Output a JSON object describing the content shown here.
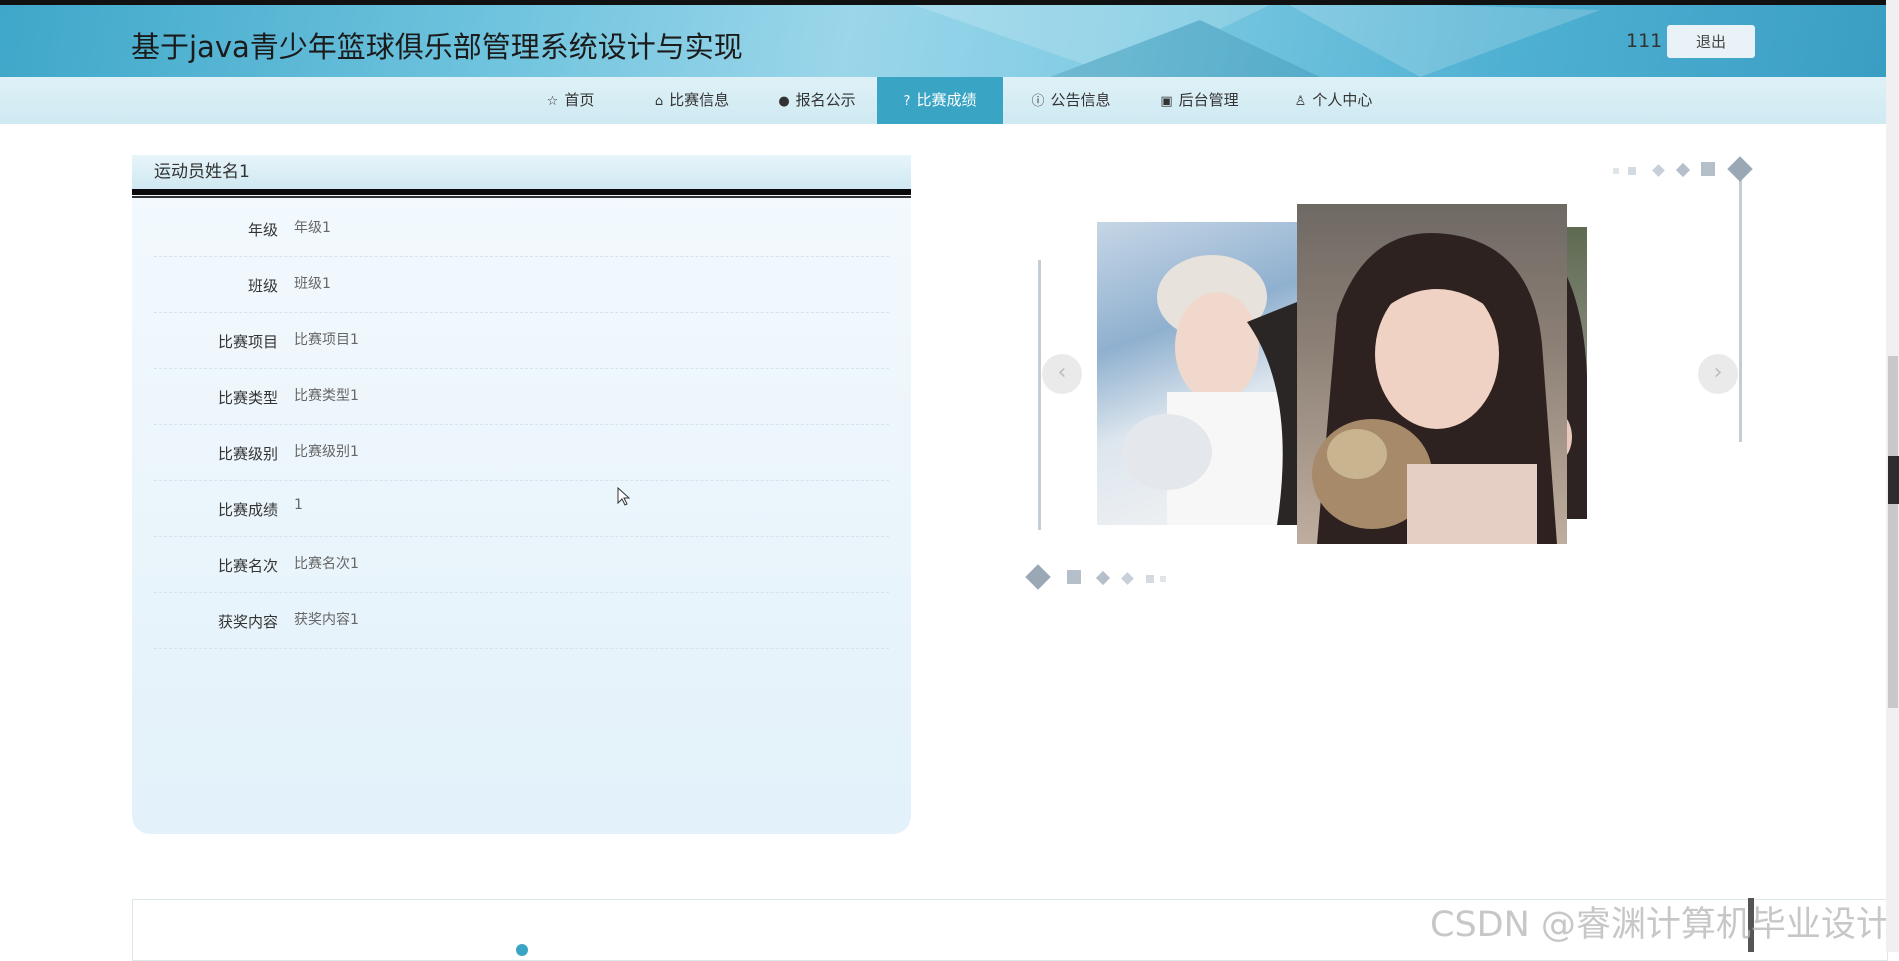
{
  "header": {
    "title": "基于java青少年篮球俱乐部管理系统设计与实现",
    "username": "111",
    "logout_label": "退出"
  },
  "nav": {
    "items": [
      {
        "label": "首页",
        "icon": "star-icon"
      },
      {
        "label": "比赛信息",
        "icon": "bag-icon"
      },
      {
        "label": "报名公示",
        "icon": "exclamation-circle-icon"
      },
      {
        "label": "比赛成绩",
        "icon": "question-circle-icon",
        "active": true
      },
      {
        "label": "公告信息",
        "icon": "info-circle-icon"
      },
      {
        "label": "后台管理",
        "icon": "gift-icon"
      },
      {
        "label": "个人中心",
        "icon": "user-icon"
      }
    ]
  },
  "detail": {
    "title": "运动员姓名1",
    "rows": [
      {
        "label": "年级",
        "value": "年级1"
      },
      {
        "label": "班级",
        "value": "班级1"
      },
      {
        "label": "比赛项目",
        "value": "比赛项目1"
      },
      {
        "label": "比赛类型",
        "value": "比赛类型1"
      },
      {
        "label": "比赛级别",
        "value": "比赛级别1"
      },
      {
        "label": "比赛成绩",
        "value": "1"
      },
      {
        "label": "比赛名次",
        "value": "比赛名次1"
      },
      {
        "label": "获奖内容",
        "value": "获奖内容1"
      }
    ]
  },
  "carousel": {
    "prev_label": "‹",
    "next_label": "›"
  },
  "watermark": "CSDN @睿渊计算机毕业设计",
  "colors": {
    "accent": "#3aa4c5",
    "header_bg": "#6cc2dd",
    "nav_bg": "#d6edf5"
  }
}
